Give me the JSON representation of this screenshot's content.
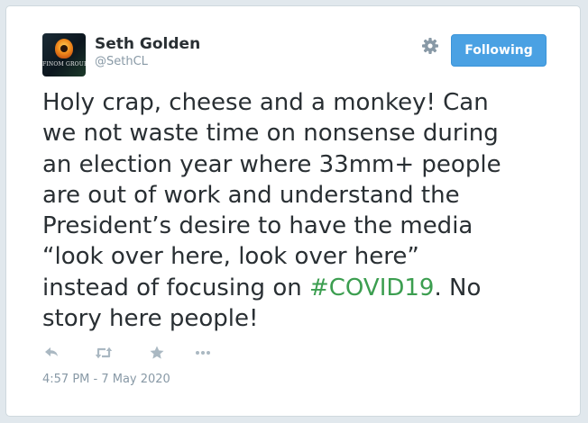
{
  "author": {
    "name": "Seth Golden",
    "handle": "@SethCL",
    "avatar_caption": "FINOM GROUP",
    "avatar_icon": "finom-group-logo"
  },
  "header": {
    "settings_icon": "gear-icon",
    "follow_button_label": "Following"
  },
  "tweet": {
    "line1": "Holy crap, cheese and a monkey! Can",
    "line2": "we not waste time on nonsense during",
    "line3": "an election year where 33mm+ people",
    "line4": "are out of work and understand the",
    "line5": "President’s desire to have the media",
    "line6": "“look over here, look over here”",
    "line7_before": "instead of focusing on ",
    "hashtag": "#COVID19",
    "line7_after": ". No",
    "line8": "story here people!"
  },
  "actions": {
    "icons": [
      "reply-icon",
      "retweet-icon",
      "favorite-icon",
      "more-icon"
    ]
  },
  "timestamp": "4:57 PM - 7 May 2020",
  "colors": {
    "accent": "#4aa1e3",
    "hashtag": "#3c9e50",
    "text": "#292f33",
    "muted": "#8899a6"
  }
}
